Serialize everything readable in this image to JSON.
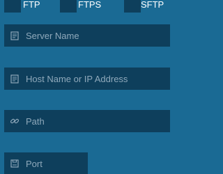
{
  "protocols": [
    {
      "label": "FTP"
    },
    {
      "label": "FTPS"
    },
    {
      "label": "SFTP"
    }
  ],
  "fields": {
    "server_name": {
      "placeholder": "Server Name",
      "icon": "server-icon"
    },
    "host": {
      "placeholder": "Host Name or IP Address",
      "icon": "server-icon"
    },
    "path": {
      "placeholder": "Path",
      "icon": "link-icon"
    },
    "port": {
      "placeholder": "Port",
      "icon": "port-icon"
    }
  },
  "colors": {
    "background": "#1a6a94",
    "field": "#0e3f5c",
    "text": "#ffffff",
    "placeholder": "#8fa9bb"
  }
}
